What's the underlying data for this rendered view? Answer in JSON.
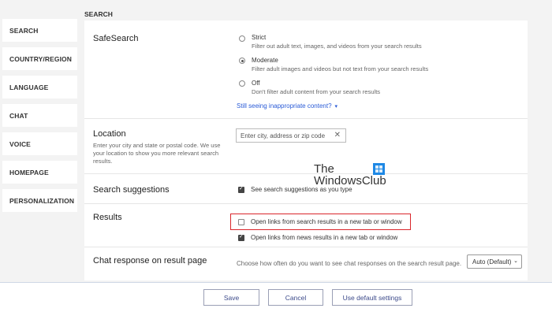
{
  "section_title": "SEARCH",
  "sidebar": {
    "items": [
      {
        "label": "SEARCH"
      },
      {
        "label": "COUNTRY/REGION"
      },
      {
        "label": "LANGUAGE"
      },
      {
        "label": "CHAT"
      },
      {
        "label": "VOICE"
      },
      {
        "label": "HOMEPAGE"
      },
      {
        "label": "PERSONALIZATION"
      }
    ]
  },
  "safesearch": {
    "label": "SafeSearch",
    "options": [
      {
        "title": "Strict",
        "desc": "Filter out adult text, images, and videos from your search results",
        "selected": false
      },
      {
        "title": "Moderate",
        "desc": "Filter adult images and videos but not text from your search results",
        "selected": true
      },
      {
        "title": "Off",
        "desc": "Don't filter adult content from your search results",
        "selected": false
      }
    ],
    "link": "Still seeing inappropriate content?"
  },
  "location": {
    "label": "Location",
    "desc": "Enter your city and state or postal code. We use your location to show you more relevant search results.",
    "placeholder": "Enter city, address or zip code"
  },
  "suggestions": {
    "label": "Search suggestions",
    "checkbox_label": "See search suggestions as you type",
    "checked": true
  },
  "results": {
    "label": "Results",
    "new_tab": "Open links from search results in a new tab or window",
    "new_tab_checked": false,
    "news_tab": "Open links from news results in a new tab or window",
    "news_tab_checked": true
  },
  "chat_response": {
    "label": "Chat response on result page",
    "desc": "Choose how often do you want to see chat responses on the search result page.",
    "selected": "Auto (Default)"
  },
  "watermark": {
    "line1": "The",
    "line2": "WindowsClub"
  },
  "footer": {
    "save": "Save",
    "cancel": "Cancel",
    "default": "Use default settings"
  },
  "colors": {
    "accent": "#2a5bd7",
    "highlight": "#d9262b",
    "button_text": "#3c4a8a"
  }
}
